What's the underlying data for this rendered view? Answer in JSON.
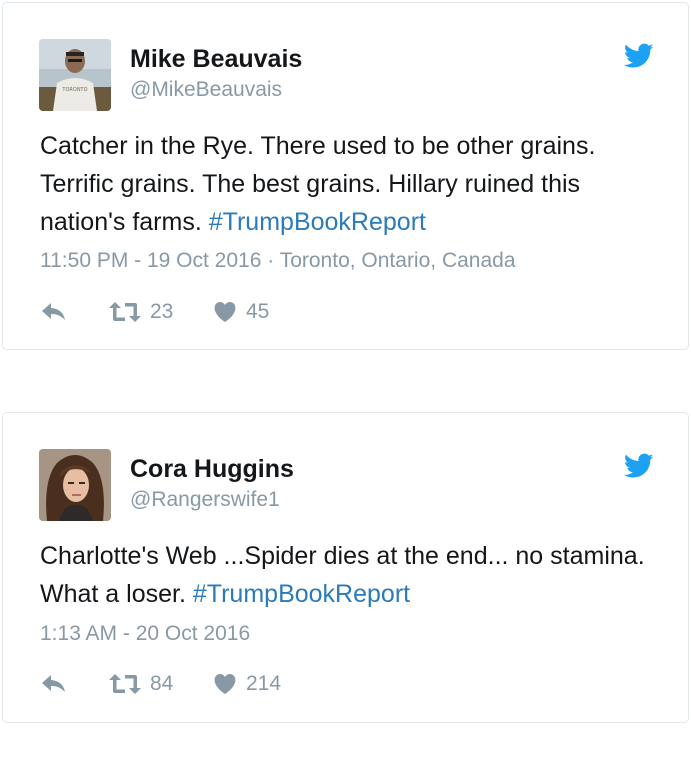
{
  "tweets": [
    {
      "display_name": "Mike Beauvais",
      "handle": "@MikeBeauvais",
      "text_before": "Catcher in the Rye. There used to be other grains. Terrific grains. The best grains. Hillary ruined this nation's farms. ",
      "hashtag": "#TrumpBookReport",
      "time": "11:50 PM - 19 Oct 2016",
      "location_separator": " · ",
      "location": "Toronto, Ontario, Canada",
      "retweets": "23",
      "likes": "45",
      "avatar_shirt_text": "TORONTO"
    },
    {
      "display_name": "Cora Huggins",
      "handle": "@Rangerswife1",
      "text_before": "Charlotte's Web ...Spider dies at the end... no stamina. What a loser. ",
      "hashtag": "#TrumpBookReport",
      "time": "1:13 AM - 20 Oct 2016",
      "retweets": "84",
      "likes": "214"
    }
  ],
  "icons": {
    "brand": "twitter-bird-icon",
    "reply": "reply-icon",
    "retweet": "retweet-icon",
    "like": "heart-icon"
  },
  "colors": {
    "brand_blue": "#1da1f2",
    "hashtag": "#2b7bb9",
    "muted": "#8899a6",
    "text": "#14171a",
    "border": "#e1e8ed"
  }
}
